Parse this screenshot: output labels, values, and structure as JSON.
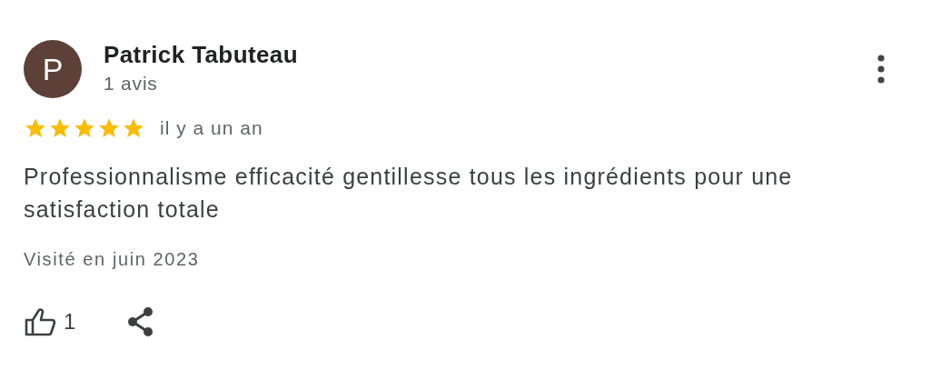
{
  "review": {
    "avatar_letter": "P",
    "author": "Patrick Tabuteau",
    "author_meta": "1 avis",
    "stars": 5,
    "time": "il y a un an",
    "text": "Professionnalisme efficacité gentillesse tous les ingrédients pour une satisfaction totale",
    "visited": "Visité en juin 2023",
    "likes": "1"
  }
}
